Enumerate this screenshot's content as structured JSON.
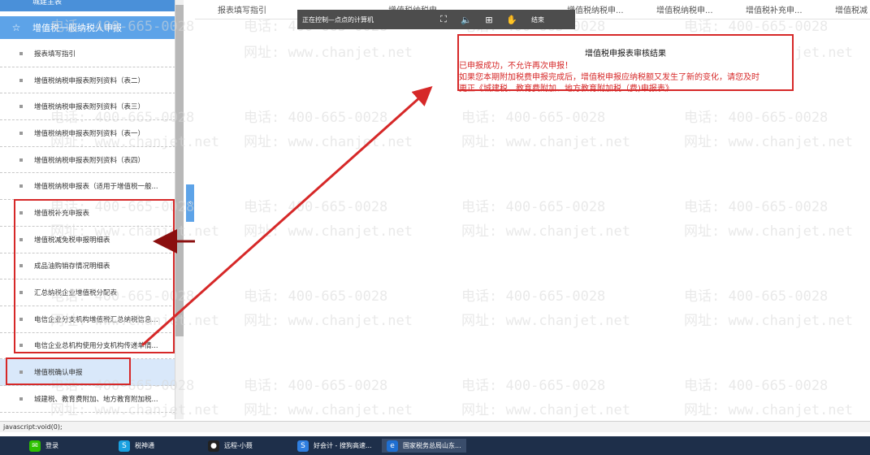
{
  "sidebar": {
    "prev_header": "城建主表",
    "header": "增值税一般纳税人申报",
    "items": [
      {
        "label": "报表填写指引"
      },
      {
        "label": "增值税纳税申报表附列资料（表二）"
      },
      {
        "label": "增值税纳税申报表附列资料（表三）"
      },
      {
        "label": "增值税纳税申报表附列资料（表一）"
      },
      {
        "label": "增值税纳税申报表附列资料（表四）"
      },
      {
        "label": "增值税纳税申报表（适用于增值税一般..."
      },
      {
        "label": "增值税补充申报表"
      },
      {
        "label": "增值税减免税申报明细表"
      },
      {
        "label": "成品油购销存情况明细表"
      },
      {
        "label": "汇总纳税企业增值税分配表"
      },
      {
        "label": "电信企业分支机构增值税汇总纳税信息..."
      },
      {
        "label": "电信企业总机构使用分支机构传递单情..."
      },
      {
        "label": "增值税确认申报"
      },
      {
        "label": "城建税、教育费附加、地方教育附加税..."
      }
    ]
  },
  "tabs": [
    "报表填写指引",
    "增值税纳税申...",
    "增值税纳税申...",
    "增值税纳税申...",
    "增值税补充申...",
    "增值税减"
  ],
  "remote_bar": {
    "title": "正在控制—点点的计算机",
    "end_label": "结束"
  },
  "dialog": {
    "title": "增值税申报表审核结果",
    "line1": "已申报成功，不允许再次申报！",
    "line2": "如果您本期附加税费申报完成后，增值税申报应纳税额又发生了新的变化，请您及时",
    "line3": "更正《城建税、教育费附加、地方教育附加税（费)申报表》"
  },
  "watermark": {
    "phone": "电话: 400-665-0028",
    "site": "网址: www.chanjet.net"
  },
  "status": {
    "text": "javascript:void(0);"
  },
  "taskbar": {
    "items": [
      {
        "label": "登录",
        "icon": "wechat-icon",
        "color": "#2dc100"
      },
      {
        "label": "税神通",
        "icon": "tax-app-icon",
        "color": "#1aa1e0"
      },
      {
        "label": "远程-小聂",
        "icon": "qq-icon",
        "color": "#222222"
      },
      {
        "label": "好会计 - 搜狗高速...",
        "icon": "sogou-browser-icon",
        "color": "#2f7fe0"
      },
      {
        "label": "国家税务总局山东...",
        "icon": "ie-icon",
        "color": "#1f6fd1"
      }
    ]
  },
  "colors": {
    "sidebar_header": "#5da3e8",
    "annotation_red": "#d62828",
    "taskbar": "#1e2f4a"
  }
}
